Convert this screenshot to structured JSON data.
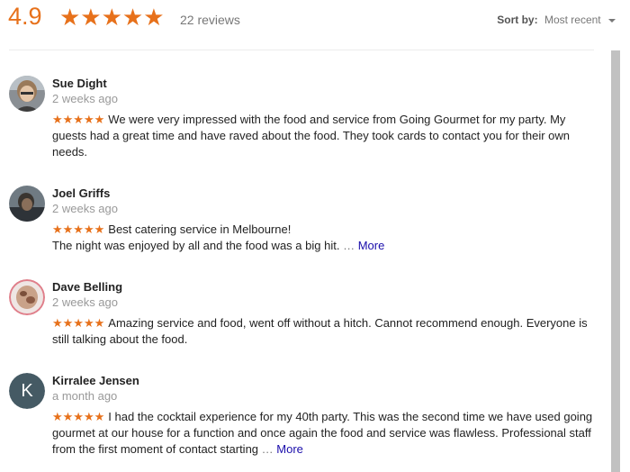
{
  "header": {
    "rating": "4.9",
    "stars": "★★★★★",
    "review_count": "22 reviews",
    "sort_label": "Sort by:",
    "sort_value": "Most recent"
  },
  "colors": {
    "star": "#e7711b",
    "link": "#1a0dab",
    "avatar_k_bg": "#455a64"
  },
  "reviews": [
    {
      "name": "Sue Dight",
      "date": "2 weeks ago",
      "stars": "★★★★★",
      "rating": 5,
      "text": "We were very impressed with the food and service from Going Gourmet for my party. My guests had a great time and have raved about the food.  They took cards to contact you for their own needs."
    },
    {
      "name": "Joel Griffs",
      "date": "2 weeks ago",
      "stars": "★★★★★",
      "rating": 5,
      "text_line1": "Best catering service in Melbourne!",
      "text_line2": "The night was enjoyed by all and the food was a big hit.",
      "ellipsis": "…",
      "more": "More"
    },
    {
      "name": "Dave Belling",
      "date": "2 weeks ago",
      "stars": "★★★★★",
      "rating": 5,
      "text": "Amazing service and food, went off without a hitch. Cannot recommend enough. Everyone is still talking about the food."
    },
    {
      "name": "Kirralee Jensen",
      "date": "a month ago",
      "stars": "★★★★★",
      "rating": 5,
      "avatar_letter": "K",
      "text": "I had the cocktail experience for my 40th party. This was the second time we have used going gourmet at our house for a function and once again the food and service was flawless. Professional staff from the first moment of contact starting",
      "ellipsis": "…",
      "more": "More"
    }
  ]
}
